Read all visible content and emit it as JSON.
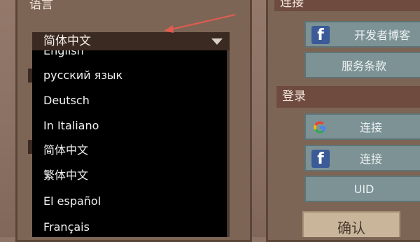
{
  "language_section": {
    "header": "语言",
    "selected": "简体中文",
    "options": [
      "English",
      "русский язык",
      "Deutsch",
      "In Italiano",
      "简体中文",
      "繁体中文",
      "El español",
      "Français"
    ]
  },
  "connect_section": {
    "header": "连接",
    "developer_blog_label": "开发者博客",
    "terms_label": "服务条款"
  },
  "login_section": {
    "header": "登录",
    "google_connect_label": "连接",
    "facebook_connect_label": "连接",
    "uid_label": "UID"
  },
  "confirm_label": "确认",
  "icons": {
    "facebook": "facebook-icon",
    "google": "google-icon",
    "dropdown": "caret-down-icon",
    "annotation": "red-arrow"
  },
  "colors": {
    "panel": "#7d6556",
    "button": "#7c9295",
    "dropdown_bg": "#000000",
    "facebook_blue": "#3b5a98",
    "annotation_red": "#e25b4f"
  }
}
